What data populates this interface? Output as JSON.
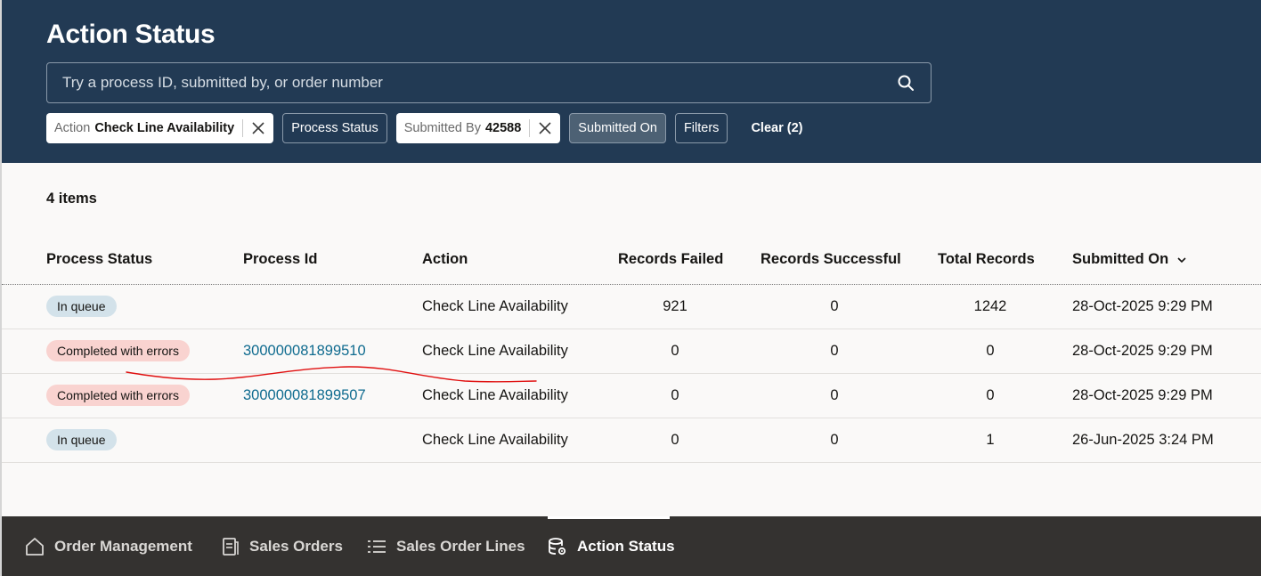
{
  "header": {
    "title": "Action Status",
    "search_placeholder": "Try a process ID, submitted by, or order number"
  },
  "filters": [
    {
      "key": "Action",
      "value": "Check Line Availability"
    },
    {
      "label": "Process Status"
    },
    {
      "key": "Submitted By",
      "value": "42588"
    },
    {
      "label": "Submitted On"
    },
    {
      "label": "Filters"
    },
    {
      "label": "Clear (2)"
    }
  ],
  "table": {
    "count_label": "4 items",
    "columns": [
      "Process Status",
      "Process Id",
      "Action",
      "Records Failed",
      "Records Successful",
      "Total Records",
      "Submitted On"
    ],
    "rows": [
      {
        "status": "In queue",
        "process_id": "",
        "action": "Check Line Availability",
        "failed": "921",
        "successful": "0",
        "total": "1242",
        "submitted_on": "28-Oct-2025 9:29 PM"
      },
      {
        "status": "Completed with errors",
        "process_id": "300000081899510",
        "action": "Check Line Availability",
        "failed": "0",
        "successful": "0",
        "total": "0",
        "submitted_on": "28-Oct-2025 9:29 PM"
      },
      {
        "status": "Completed with errors",
        "process_id": "300000081899507",
        "action": "Check Line Availability",
        "failed": "0",
        "successful": "0",
        "total": "0",
        "submitted_on": "28-Oct-2025 9:29 PM"
      },
      {
        "status": "In queue",
        "process_id": "",
        "action": "Check Line Availability",
        "failed": "0",
        "successful": "0",
        "total": "1",
        "submitted_on": "26-Jun-2025 3:24 PM"
      }
    ]
  },
  "bottom_nav": {
    "items": [
      {
        "label": "Order Management",
        "icon": "home-icon"
      },
      {
        "label": "Sales Orders",
        "icon": "document-icon"
      },
      {
        "label": "Sales Order Lines",
        "icon": "list-icon"
      },
      {
        "label": "Action Status",
        "icon": "database-gear-icon",
        "active": true
      }
    ]
  },
  "colors": {
    "header_bg": "#223a54",
    "content_bg": "#faf9f8",
    "nav_bg": "#343230",
    "link": "#0f6b8f",
    "badge_queue": "#d3e2ea",
    "badge_error": "#f9d3d0",
    "annotation": "#e01010"
  }
}
